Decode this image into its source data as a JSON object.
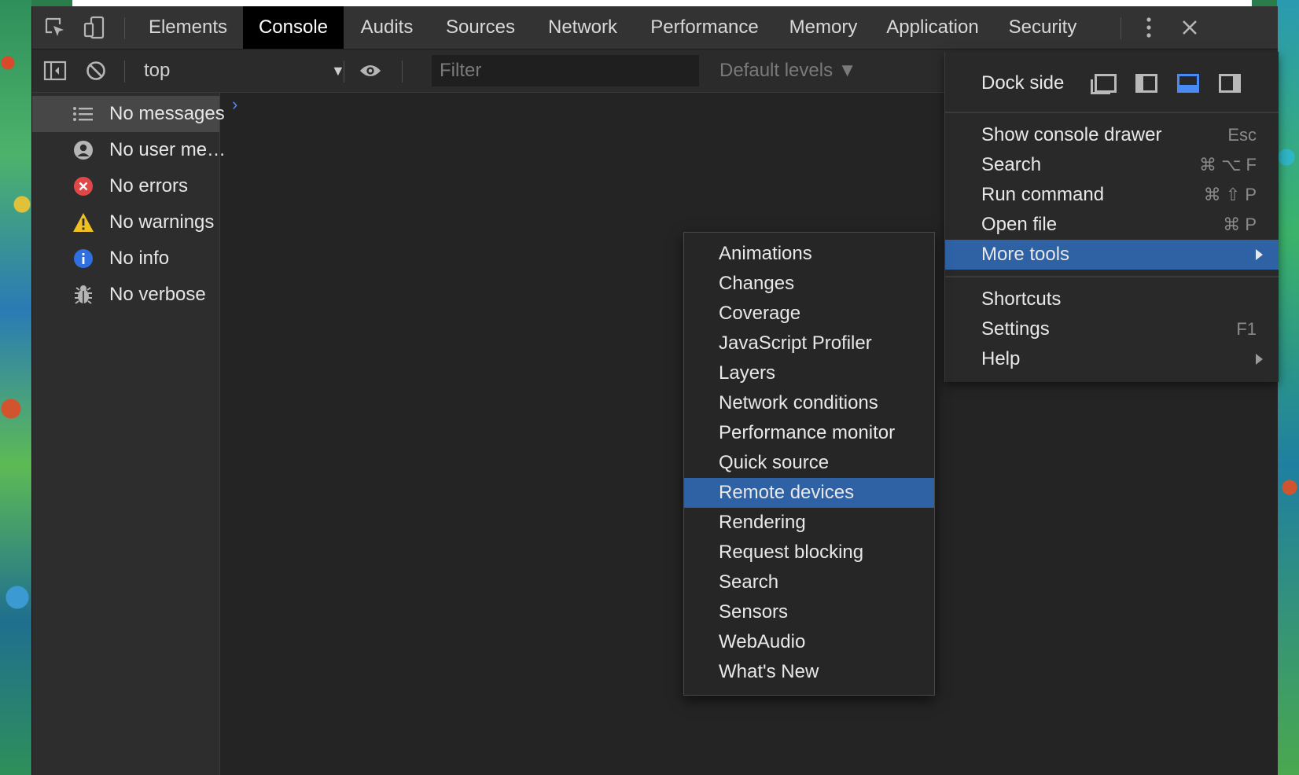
{
  "colors": {
    "accent_blue": "#2f62a5",
    "panel_bg": "#242424",
    "active_tab_bg": "#000000",
    "error_red": "#e04848",
    "warning_yellow": "#f0c020",
    "info_blue": "#2f6fe0"
  },
  "tabs": [
    {
      "label": "Elements"
    },
    {
      "label": "Console"
    },
    {
      "label": "Audits"
    },
    {
      "label": "Sources"
    },
    {
      "label": "Network"
    },
    {
      "label": "Performance"
    },
    {
      "label": "Memory"
    },
    {
      "label": "Application"
    },
    {
      "label": "Security"
    }
  ],
  "toolbar": {
    "context": "top",
    "context_arrow": "▼",
    "filter_placeholder": "Filter",
    "levels": "Default levels ▼"
  },
  "sidebar": {
    "items": [
      {
        "label": "No messages",
        "icon": "list-icon"
      },
      {
        "label": "No user me…",
        "icon": "user-icon"
      },
      {
        "label": "No errors",
        "icon": "error-icon"
      },
      {
        "label": "No warnings",
        "icon": "warning-icon"
      },
      {
        "label": "No info",
        "icon": "info-icon"
      },
      {
        "label": "No verbose",
        "icon": "bug-icon"
      }
    ]
  },
  "console": {
    "prompt": "›"
  },
  "main_menu": {
    "dock_side_label": "Dock side",
    "items": [
      {
        "label": "Show console drawer",
        "shortcut": "Esc"
      },
      {
        "label": "Search",
        "shortcut": "⌘ ⌥ F"
      },
      {
        "label": "Run command",
        "shortcut": "⌘ ⇧ P"
      },
      {
        "label": "Open file",
        "shortcut": "⌘ P"
      },
      {
        "label": "More tools",
        "shortcut": ""
      },
      {
        "label": "Shortcuts",
        "shortcut": ""
      },
      {
        "label": "Settings",
        "shortcut": "F1"
      },
      {
        "label": "Help",
        "shortcut": ""
      }
    ]
  },
  "more_tools_menu": {
    "items": [
      "Animations",
      "Changes",
      "Coverage",
      "JavaScript Profiler",
      "Layers",
      "Network conditions",
      "Performance monitor",
      "Quick source",
      "Remote devices",
      "Rendering",
      "Request blocking",
      "Search",
      "Sensors",
      "WebAudio",
      "What's New"
    ]
  }
}
